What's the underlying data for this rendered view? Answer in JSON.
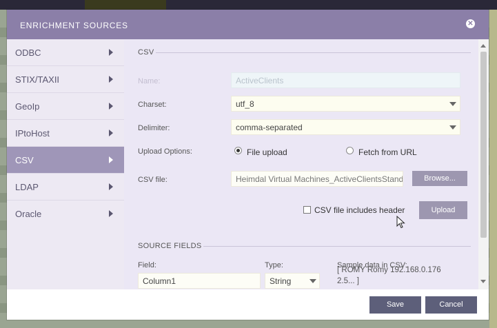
{
  "modal": {
    "title": "ENRICHMENT SOURCES"
  },
  "sidebar": {
    "items": [
      {
        "label": "ODBC"
      },
      {
        "label": "STIX/TAXII"
      },
      {
        "label": "GeoIp"
      },
      {
        "label": "IPtoHost"
      },
      {
        "label": "CSV"
      },
      {
        "label": "LDAP"
      },
      {
        "label": "Oracle"
      }
    ],
    "active": "CSV"
  },
  "csv": {
    "section_title": "CSV",
    "name_label": "Name:",
    "name_value": "ActiveClients",
    "charset_label": "Charset:",
    "charset_value": "utf_8",
    "delimiter_label": "Delimiter:",
    "delimiter_value": "comma-separated",
    "upload_options_label": "Upload Options:",
    "option_file_upload": "File upload",
    "option_fetch_url": "Fetch from URL",
    "csv_file_label": "CSV file:",
    "csv_file_value": "Heimdal Virtual Machines_ActiveClientsStand",
    "browse_label": "Browse...",
    "header_checkbox_label": "CSV file includes header",
    "upload_label": "Upload"
  },
  "source_fields": {
    "section_title": "SOURCE FIELDS",
    "field_label": "Field:",
    "field_value": "Column1",
    "type_label": "Type:",
    "type_value": "String",
    "sample_label": "Sample data in CSV:",
    "sample_value": "[ ROMY Romy 192.168.0.176 2.5... ]"
  },
  "footer": {
    "save_label": "Save",
    "cancel_label": "Cancel"
  },
  "colors": {
    "header": "#8b7fa8",
    "sidebar_active": "#9f96b8",
    "content_bg": "#ebe7f5",
    "footer_button": "#5d5f7a"
  }
}
